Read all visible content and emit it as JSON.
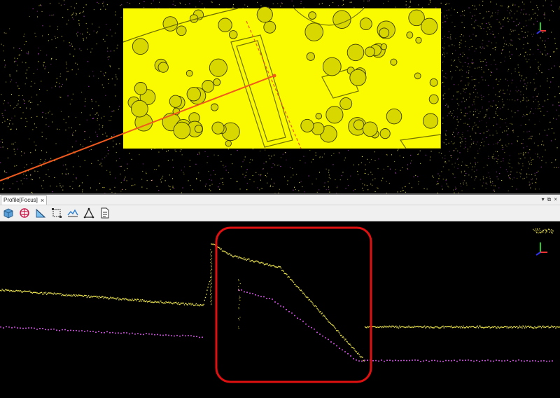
{
  "profile_panel": {
    "tab_title": "Profile[Focus]",
    "tab_close_glyph": "×",
    "panel_menu_glyph": "▾",
    "panel_float_glyph": "⧉",
    "panel_close_glyph": "×"
  },
  "toolbar": {
    "icons": [
      "view-3d-icon",
      "sphere-icon",
      "section-icon",
      "bounding-box-icon",
      "terrain-icon",
      "triangle-icon",
      "report-icon"
    ]
  },
  "colors": {
    "ground_points": "#e9e24a",
    "classified_points": "#c04ccf",
    "top_raster": "#fafa00",
    "section_line": "#f05a1c",
    "highlight_rect": "#e01010",
    "axis_x": "#e33",
    "axis_y": "#2c2",
    "axis_z": "#33e"
  }
}
